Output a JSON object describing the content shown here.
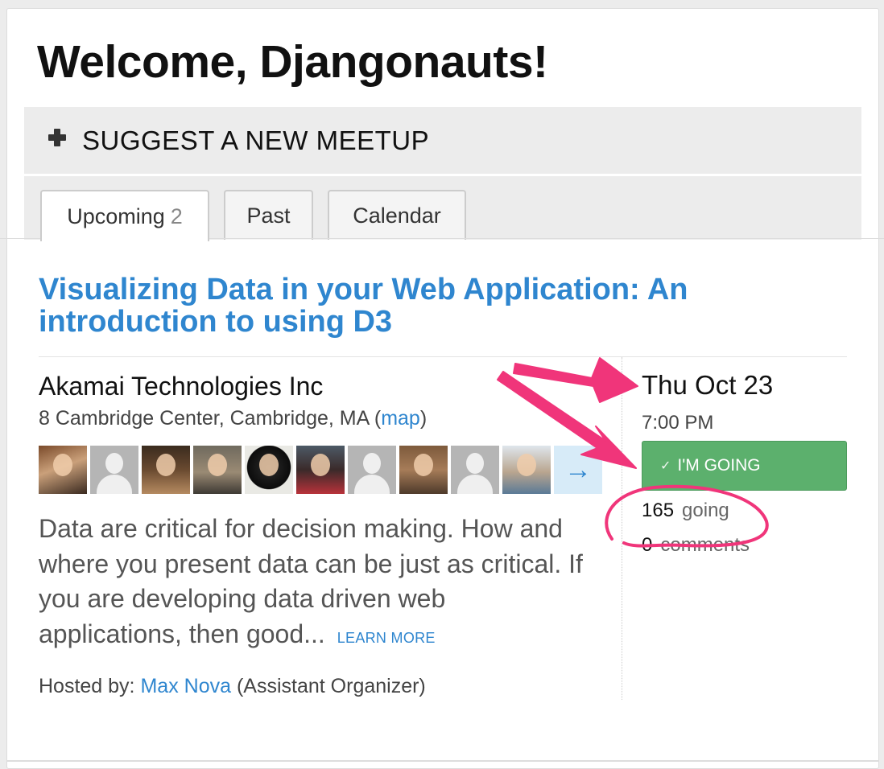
{
  "page": {
    "title": "Welcome, Djangonauts!"
  },
  "suggest": {
    "label": "SUGGEST A NEW MEETUP"
  },
  "tabs": [
    {
      "label": "Upcoming",
      "count": "2"
    },
    {
      "label": "Past"
    },
    {
      "label": "Calendar"
    }
  ],
  "event": {
    "title": "Visualizing Data in your Web Application: An introduction to using D3",
    "venue_name": "Akamai Technologies Inc",
    "venue_address": "8 Cambridge Center, Cambridge, MA",
    "map_link": "map",
    "attendee_avatars": [
      "photo",
      "generic",
      "photo",
      "photo",
      "photo",
      "photo",
      "generic",
      "photo",
      "generic",
      "photo"
    ],
    "description": "Data are critical for decision making. How and where you present data can be just as critical. If you are developing data driven web applications, then good...",
    "learn_more": "LEARN MORE",
    "hosted_prefix": "Hosted by:",
    "host_name": "Max Nova",
    "host_role": "(Assistant Organizer)",
    "date": "Thu Oct 23",
    "time": "7:00 PM",
    "rsvp_label": "I'M GOING",
    "going_count": "165",
    "going_label": "going",
    "comments_count": "0",
    "comments_label": "comments"
  },
  "icons": {
    "plus": "plus-icon",
    "check": "check-icon",
    "more_attendees": "arrow-right-icon"
  },
  "colors": {
    "link": "#2f86cf",
    "rsvp_button": "#5cb06d",
    "annotation": "#f0357a"
  }
}
